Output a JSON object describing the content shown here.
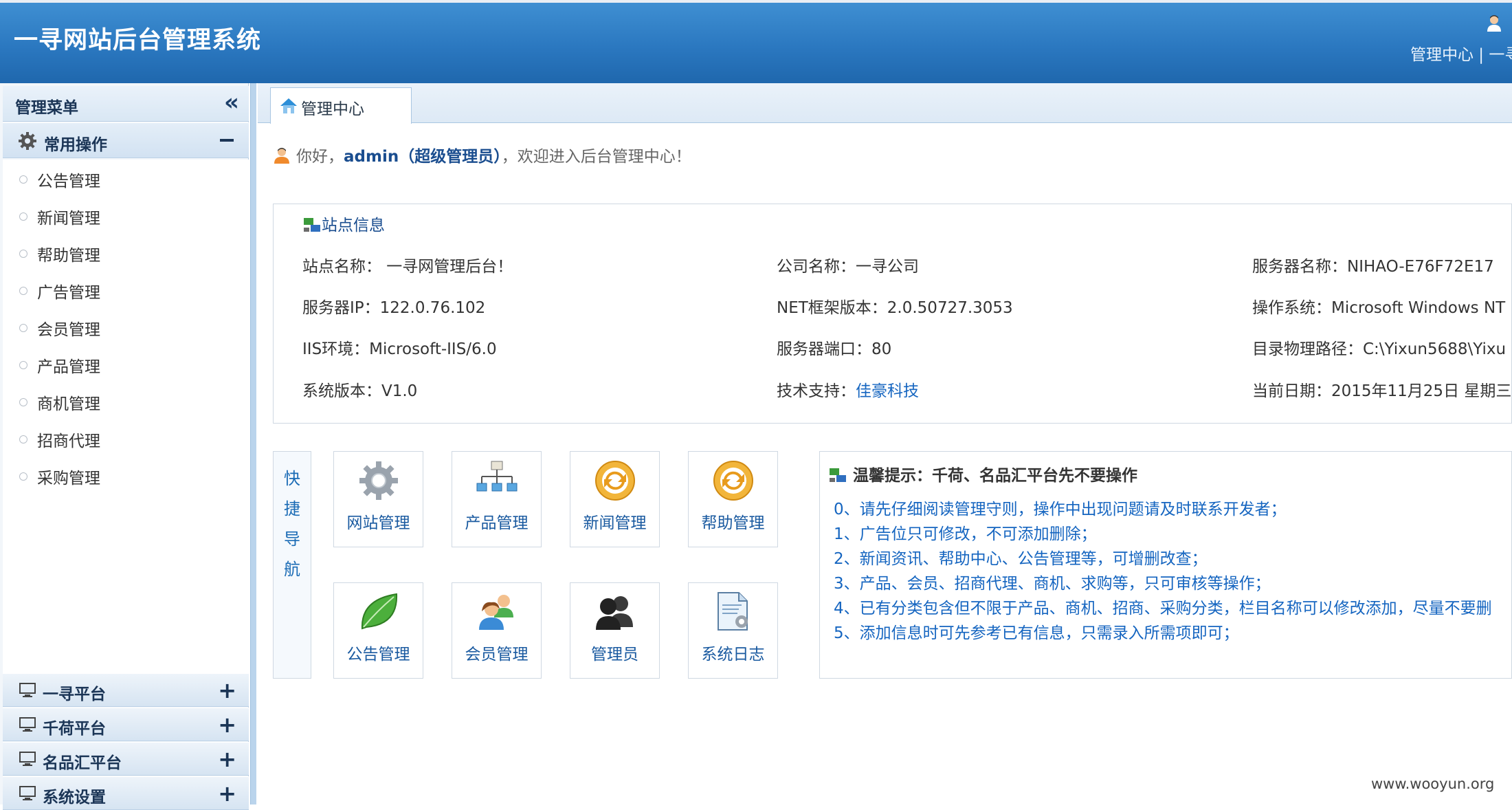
{
  "header": {
    "title": "一寻网站后台管理系统",
    "links": "管理中心 | 一寻"
  },
  "sidebar": {
    "heading": "管理菜单",
    "collapse_icon": "«",
    "open_group": {
      "label": "常用操作",
      "items": [
        "公告管理",
        "新闻管理",
        "帮助管理",
        "广告管理",
        "会员管理",
        "产品管理",
        "商机管理",
        "招商代理",
        "采购管理"
      ]
    },
    "closed_groups": [
      "一寻平台",
      "千荷平台",
      "名品汇平台",
      "系统设置"
    ]
  },
  "tab": {
    "label": "管理中心"
  },
  "greeting": {
    "prefix": "你好，",
    "user": "admin（超级管理员）",
    "suffix": "，欢迎进入后台管理中心！"
  },
  "site_info": {
    "title": "站点信息",
    "rows": [
      [
        "站点名称：  一寻网管理后台！",
        "公司名称：一寻公司",
        "服务器名称：NIHAO-E76F72E17"
      ],
      [
        "服务器IP：122.0.76.102",
        "NET框架版本：2.0.50727.3053",
        "操作系统：Microsoft Windows NT"
      ],
      [
        "IIS环境：Microsoft-IIS/6.0",
        "服务器端口：80",
        "目录物理路径：C:\\Yixun5688\\Yixu"
      ],
      [
        "系统版本：V1.0",
        "技术支持：",
        "当前日期：2015年11月25日 星期三"
      ]
    ],
    "tech_support_link": "佳豪科技"
  },
  "quick_nav": {
    "label_chars": [
      "快",
      "捷",
      "导",
      "航"
    ],
    "buttons": [
      {
        "label": "网站管理",
        "icon": "gear-icon"
      },
      {
        "label": "产品管理",
        "icon": "sitemap-icon"
      },
      {
        "label": "新闻管理",
        "icon": "refresh-icon"
      },
      {
        "label": "帮助管理",
        "icon": "refresh-icon"
      },
      {
        "label": "公告管理",
        "icon": "leaf-icon"
      },
      {
        "label": "会员管理",
        "icon": "users-icon"
      },
      {
        "label": "管理员",
        "icon": "admins-icon"
      },
      {
        "label": "系统日志",
        "icon": "log-file-icon"
      }
    ]
  },
  "tips": {
    "title": "温馨提示：千荷、名品汇平台先不要操作",
    "items": [
      "0、请先仔细阅读管理守则，操作中出现问题请及时联系开发者；",
      "1、广告位只可修改，不可添加删除；",
      "2、新闻资讯、帮助中心、公告管理等，可增删改查；",
      "3、产品、会员、招商代理、商机、求购等，只可审核等操作；",
      "4、已有分类包含但不限于产品、商机、招商、采购分类，栏目名称可以修改添加，尽量不要删",
      "5、添加信息时可先参考已有信息，只需录入所需项即可；"
    ]
  },
  "watermark": "www.wooyun.org",
  "colors": {
    "header": "#2b78c0",
    "link": "#1565c0",
    "accent": "#1a4d8f"
  }
}
